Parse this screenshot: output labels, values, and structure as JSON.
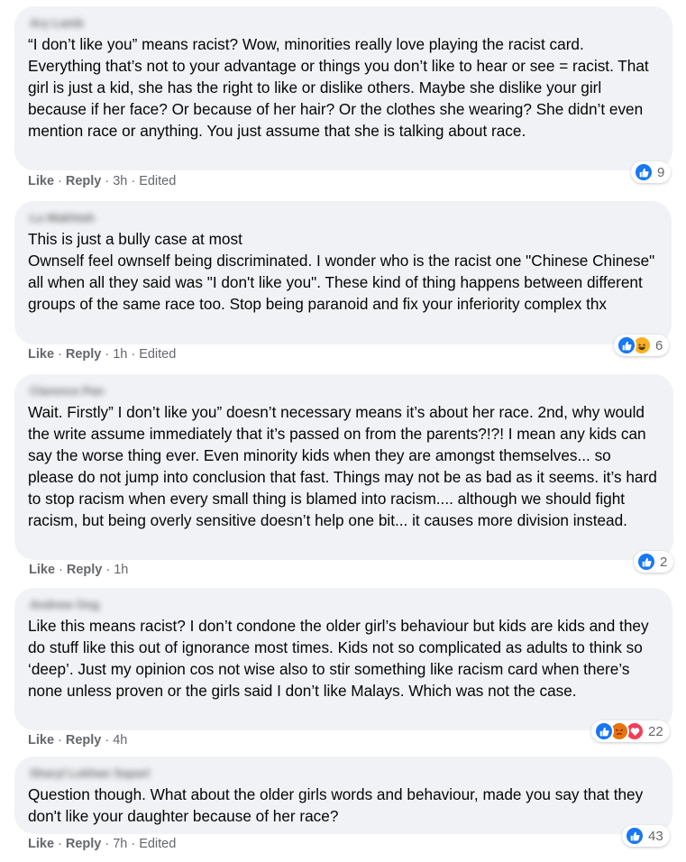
{
  "colors": {
    "bubble_bg": "#f0f2f5",
    "text": "#050505",
    "meta": "#65676b",
    "like_blue": "#1877f2",
    "haha_yellow": "#f7b125",
    "angry_orange": "#e9710f",
    "love_red": "#f33e58"
  },
  "actions": {
    "like_label": "Like",
    "reply_label": "Reply",
    "edited_label": "Edited",
    "dot": "·"
  },
  "comments": [
    {
      "author": "Ary Lamb",
      "text": "“I don’t like you” means racist? Wow, minorities really love playing the racist card. Everything that’s not to your advantage or things you don’t like to hear or see = racist. That girl is just a kid, she has the right to like or dislike others. Maybe she dislike your girl because if her face? Or because of her hair? Or the clothes she wearing? She didn’t even mention race or anything. You just assume that she is talking about race.",
      "time": "3h",
      "edited": true,
      "reactions": [
        "like-icon"
      ],
      "reaction_count": "9"
    },
    {
      "author": "Lu Makhtah",
      "text": "This is just a bully case at most\nOwnself feel ownself being discriminated. I wonder who is the racist one \"Chinese Chinese\" all when all they said was \"I don't like you\". These kind of thing happens between different groups of the same race too. Stop being paranoid and fix your inferiority complex thx",
      "time": "1h",
      "edited": true,
      "reactions": [
        "like-icon",
        "haha-icon"
      ],
      "reaction_count": "6"
    },
    {
      "author": "Clarence Pan",
      "text": "Wait. Firstly” I don’t like you” doesn’t necessary means it’s about her race. 2nd, why would the write assume immediately that it’s passed on from the parents?!?! I mean any kids can say the worse thing ever. Even minority kids when they are amongst themselves... so please do not jump into conclusion that fast. Things may not be as bad as it seems. it’s hard to stop racism when every small thing is blamed into racism.... although we should fight racism, but being overly sensitive doesn’t help one bit... it causes more division instead.",
      "time": "1h",
      "edited": false,
      "reactions": [
        "like-icon"
      ],
      "reaction_count": "2"
    },
    {
      "author": "Andrew Ong",
      "text": "Like this means racist? I don’t condone the older girl’s behaviour but kids are kids and they do stuff like this out of ignorance most times. Kids not so complicated as adults to think so ‘deep’. Just my opinion cos not wise also to stir something like racism card when there’s none unless proven or the girls said I don’t like Malays. Which was not the case.",
      "time": "4h",
      "edited": false,
      "reactions": [
        "like-icon",
        "angry-icon",
        "love-icon"
      ],
      "reaction_count": "22"
    },
    {
      "author": "Sharyl Lokhan Saparl",
      "text": "Question though. What about the older girls words and behaviour, made you say that they don't like your daughter because of her race?",
      "time": "7h",
      "edited": true,
      "reactions": [
        "like-icon"
      ],
      "reaction_count": "43"
    }
  ]
}
